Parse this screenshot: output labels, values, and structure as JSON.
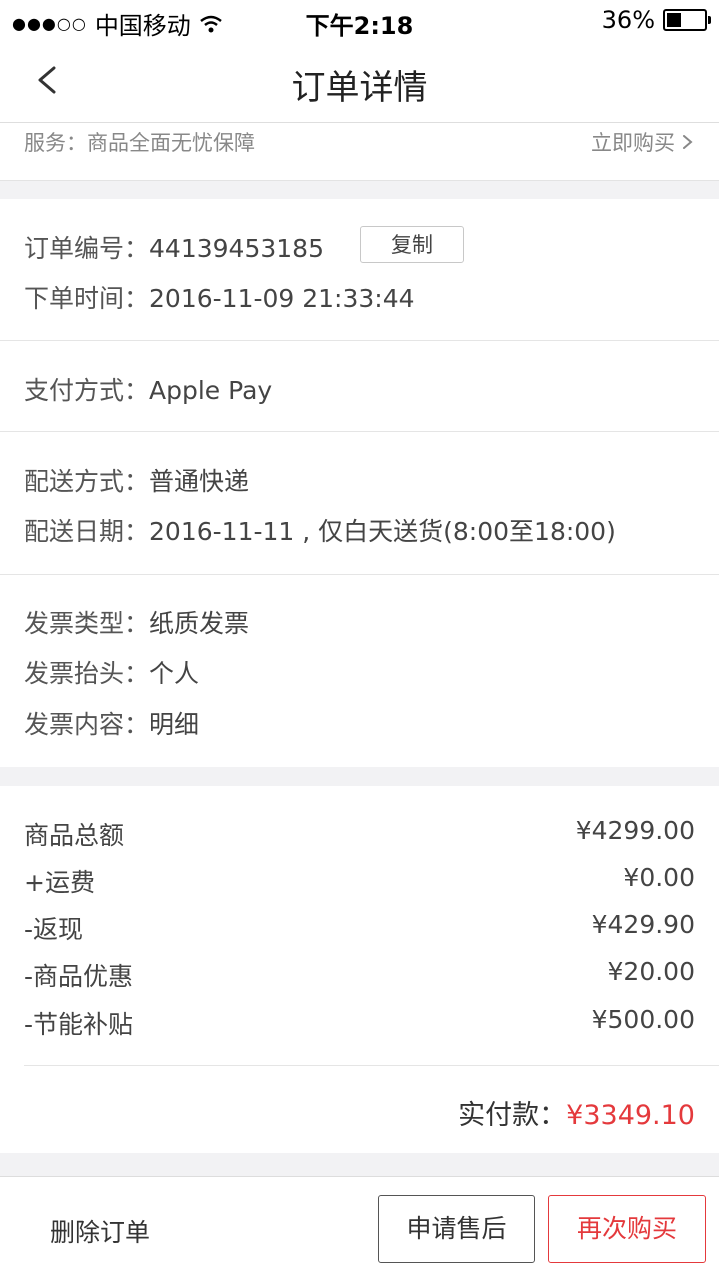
{
  "status_bar": {
    "carrier": "中国移动",
    "signal": "●●●○○",
    "time": "下午2:18",
    "battery": "36%"
  },
  "nav": {
    "title": "订单详情"
  },
  "service": {
    "label": "服务：商品全面无忧保障",
    "link": "立即购买"
  },
  "order": {
    "number_label": "订单编号：",
    "number": "44139453185",
    "copy_label": "复制",
    "time_label": "下单时间：",
    "time": "2016-11-09 21:33:44"
  },
  "payment": {
    "label": "支付方式：",
    "value": "Apple Pay"
  },
  "delivery": {
    "method_label": "配送方式：",
    "method": "普通快递",
    "date_label": "配送日期：",
    "date": "2016-11-11 , 仅白天送货(8:00至18:00)"
  },
  "invoice": {
    "type_label": "发票类型：",
    "type": "纸质发票",
    "title_label": "发票抬头：",
    "title": "个人",
    "content_label": "发票内容：",
    "content": "明细"
  },
  "amounts": [
    {
      "label": "商品总额",
      "value": "¥4299.00"
    },
    {
      "label": "+运费",
      "value": "¥0.00"
    },
    {
      "label": "-返现",
      "value": "¥429.90"
    },
    {
      "label": "-商品优惠",
      "value": "¥20.00"
    },
    {
      "label": "-节能补贴",
      "value": "¥500.00"
    }
  ],
  "total": {
    "label": "实付款：",
    "value": "¥3349.10"
  },
  "actions": {
    "delete": "删除订单",
    "after_sales": "申请售后",
    "rebuy": "再次购买"
  },
  "colors": {
    "accent_red": "#e4393c"
  }
}
